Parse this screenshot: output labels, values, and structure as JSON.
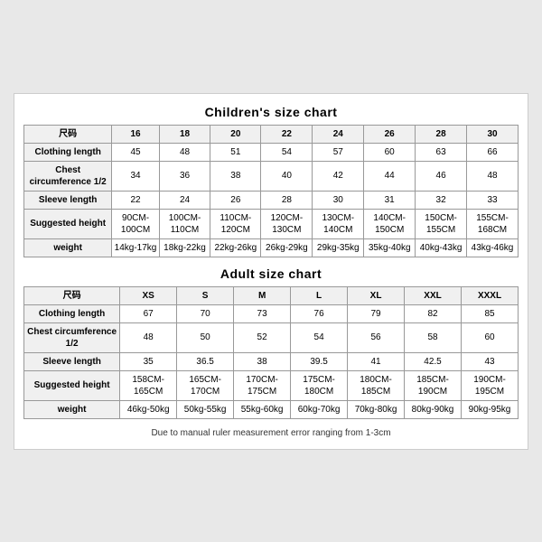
{
  "children_chart": {
    "title": "Children's size chart",
    "columns": [
      "尺码",
      "16",
      "18",
      "20",
      "22",
      "24",
      "26",
      "28",
      "30"
    ],
    "rows": [
      {
        "label": "Clothing length",
        "values": [
          "45",
          "48",
          "51",
          "54",
          "57",
          "60",
          "63",
          "66"
        ]
      },
      {
        "label": "Chest circumference 1/2",
        "values": [
          "34",
          "36",
          "38",
          "40",
          "42",
          "44",
          "46",
          "48"
        ]
      },
      {
        "label": "Sleeve length",
        "values": [
          "22",
          "24",
          "26",
          "28",
          "30",
          "31",
          "32",
          "33"
        ]
      },
      {
        "label": "Suggested height",
        "values": [
          "90CM-100CM",
          "100CM-110CM",
          "110CM-120CM",
          "120CM-130CM",
          "130CM-140CM",
          "140CM-150CM",
          "150CM-155CM",
          "155CM-168CM"
        ]
      },
      {
        "label": "weight",
        "values": [
          "14kg-17kg",
          "18kg-22kg",
          "22kg-26kg",
          "26kg-29kg",
          "29kg-35kg",
          "35kg-40kg",
          "40kg-43kg",
          "43kg-46kg"
        ]
      }
    ]
  },
  "adult_chart": {
    "title": "Adult size chart",
    "columns": [
      "尺码",
      "XS",
      "S",
      "M",
      "L",
      "XL",
      "XXL",
      "XXXL"
    ],
    "rows": [
      {
        "label": "Clothing length",
        "values": [
          "67",
          "70",
          "73",
          "76",
          "79",
          "82",
          "85"
        ]
      },
      {
        "label": "Chest circumference 1/2",
        "values": [
          "48",
          "50",
          "52",
          "54",
          "56",
          "58",
          "60"
        ]
      },
      {
        "label": "Sleeve length",
        "values": [
          "35",
          "36.5",
          "38",
          "39.5",
          "41",
          "42.5",
          "43"
        ]
      },
      {
        "label": "Suggested height",
        "values": [
          "158CM-165CM",
          "165CM-170CM",
          "170CM-175CM",
          "175CM-180CM",
          "180CM-185CM",
          "185CM-190CM",
          "190CM-195CM"
        ]
      },
      {
        "label": "weight",
        "values": [
          "46kg-50kg",
          "50kg-55kg",
          "55kg-60kg",
          "60kg-70kg",
          "70kg-80kg",
          "80kg-90kg",
          "90kg-95kg"
        ]
      }
    ]
  },
  "footer": "Due to manual ruler measurement error ranging from 1-3cm"
}
